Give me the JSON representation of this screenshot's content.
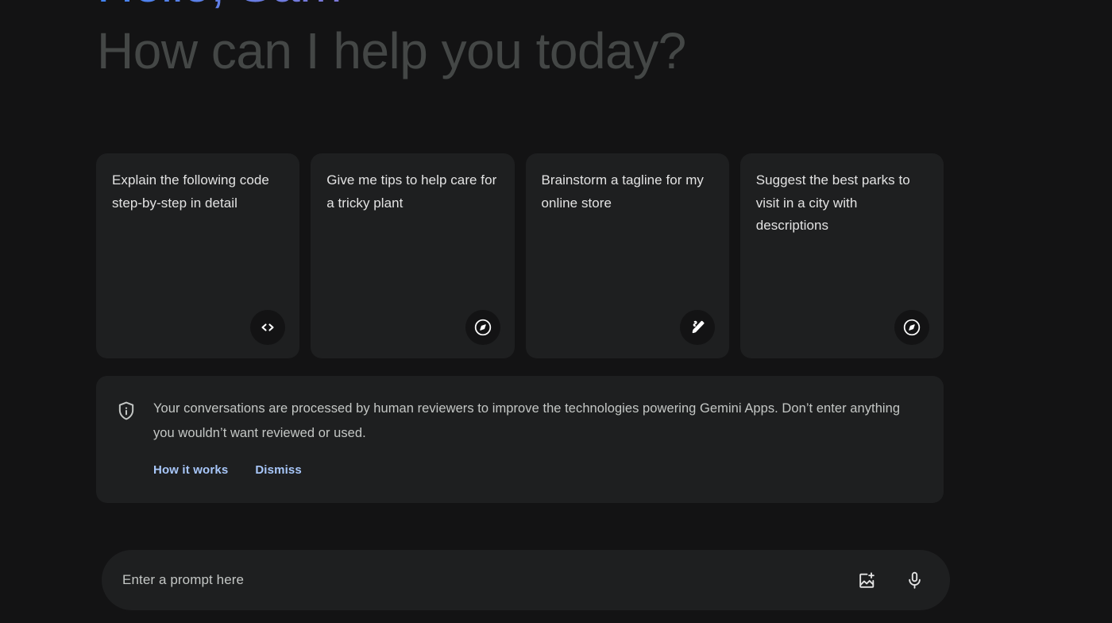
{
  "app": {
    "name": "Gemini",
    "background_color": "#131314",
    "surface_color": "#1e1f20",
    "link_color": "#a8c7fa",
    "muted_text_color": "#444746"
  },
  "greeting": {
    "line1": "Hello, Sam",
    "line2": "How can I help you today?"
  },
  "suggestion_cards": [
    {
      "text": "Explain the following code step-by-step in detail",
      "icon": "code-icon"
    },
    {
      "text": "Give me tips to help care for a tricky plant",
      "icon": "compass-icon"
    },
    {
      "text": "Brainstorm a tagline for my online store",
      "icon": "draft-pencil-icon"
    },
    {
      "text": "Suggest the best parks to visit in a city with descriptions",
      "icon": "compass-icon"
    }
  ],
  "notice": {
    "icon": "shield-info-icon",
    "text": "Your conversations are processed by human reviewers to improve the technologies powering Gemini Apps. Don’t enter anything you wouldn’t want reviewed or used.",
    "actions": [
      {
        "label": "How it works"
      },
      {
        "label": "Dismiss"
      }
    ]
  },
  "prompt": {
    "placeholder": "Enter a prompt here",
    "value": "",
    "actions": [
      {
        "name": "add-image-button",
        "icon": "image-plus-icon"
      },
      {
        "name": "voice-input-button",
        "icon": "microphone-icon"
      }
    ]
  }
}
